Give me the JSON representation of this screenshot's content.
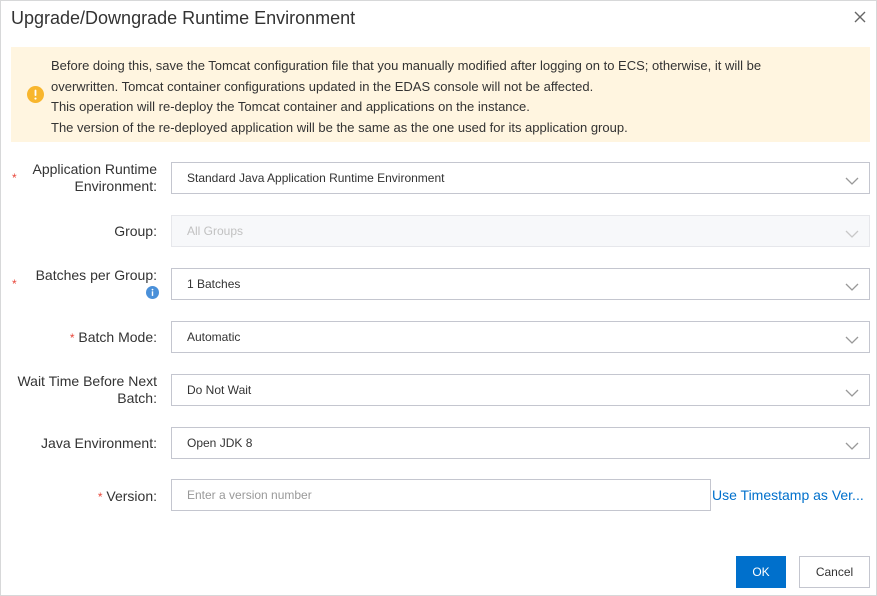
{
  "dialog": {
    "title": "Upgrade/Downgrade Runtime Environment"
  },
  "notice": {
    "lines": [
      "Before doing this, save the Tomcat configuration file that you manually modified after logging on to ECS; otherwise, it will be",
      "overwritten. Tomcat container configurations updated in the EDAS console will not be affected.",
      "This operation will re-deploy the Tomcat container and applications on the instance.",
      "The version of the re-deployed application will be the same as the one used for its application group."
    ]
  },
  "form": {
    "required_mark": "*",
    "runtime": {
      "label_line1": "Application Runtime",
      "label_line2": "Environment:",
      "value": "Standard Java Application Runtime Environment"
    },
    "group": {
      "label": "Group:",
      "value": "All Groups"
    },
    "batches": {
      "label": "Batches per Group:",
      "value": "1 Batches"
    },
    "batch_mode": {
      "label": "Batch Mode:",
      "value": "Automatic"
    },
    "wait_time": {
      "label_line1": "Wait Time Before Next",
      "label_line2": "Batch:",
      "value": "Do Not Wait"
    },
    "java_env": {
      "label": "Java Environment:",
      "value": "Open JDK 8"
    },
    "version": {
      "label": "Version:",
      "placeholder": "Enter a version number",
      "value": "",
      "timestamp_link": "Use Timestamp as Ver..."
    }
  },
  "footer": {
    "ok_label": "OK",
    "cancel_label": "Cancel"
  },
  "colors": {
    "primary": "#0070cc",
    "notice_bg": "#fff5e0",
    "warning_icon": "#f8b62d",
    "required": "#e8473b"
  }
}
